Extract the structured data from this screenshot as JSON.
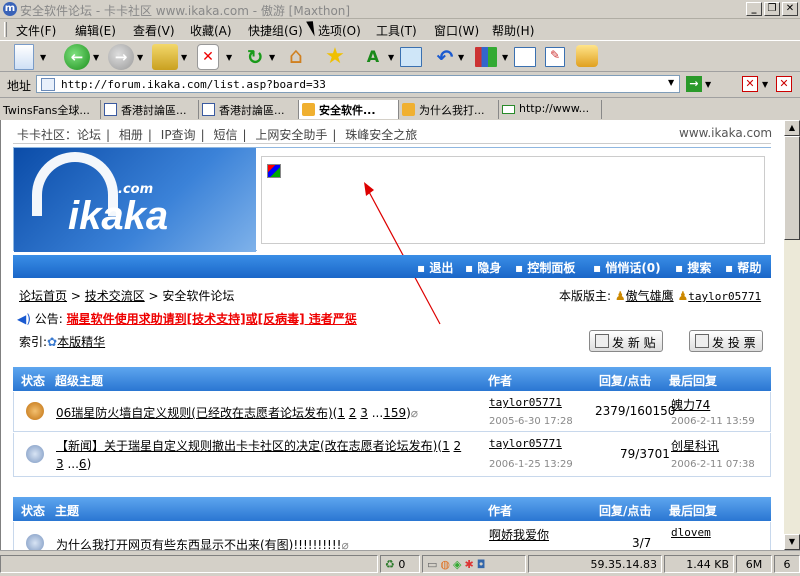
{
  "window": {
    "title": "安全软件论坛 - 卡卡社区 www.ikaka.com - 傲游 [Maxthon]"
  },
  "menu": [
    "文件(F)",
    "编辑(E)",
    "查看(V)",
    "收藏(A)",
    "快捷组(G)",
    "选项(O)",
    "工具(T)",
    "窗口(W)",
    "帮助(H)"
  ],
  "address": {
    "label": "地址",
    "url": "http://forum.ikaka.com/list.asp?board=33"
  },
  "tabs": [
    {
      "label": "TwinsFans全球..."
    },
    {
      "label": "香港討論區..."
    },
    {
      "label": "香港討論區..."
    },
    {
      "label": "安全软件..."
    },
    {
      "label": "为什么我打..."
    },
    {
      "label": "http://www..."
    }
  ],
  "page": {
    "toplinks": [
      "卡卡社区：论坛",
      "相册",
      "IP查询",
      "短信",
      "上网安全助手",
      "珠峰安全之旅"
    ],
    "site_url": "www.ikaka.com",
    "logo_text": "ikaka",
    "logo_com": ".com",
    "nav": [
      "退出",
      "隐身",
      "控制面板",
      "悄悄话(0)",
      "搜索",
      "帮助"
    ],
    "breadcrumb": {
      "home": "论坛首页",
      "section": "技术交流区",
      "current": "安全软件论坛"
    },
    "moderators": {
      "label": "本版版主:",
      "users": [
        "傲气雄鹰",
        "taylor05771"
      ]
    },
    "announcement": {
      "label": "公告:",
      "text": "瑞星软件使用求助请到[技术支持]或[反病毒] 违者严惩"
    },
    "index": {
      "label": "索引:",
      "link": "本版精华"
    },
    "buttons": {
      "new_post": "发 新 贴",
      "new_poll": "发 投 票"
    },
    "pinned_header": {
      "status": "状态",
      "topic": "超级主题",
      "author": "作者",
      "replies": "回复/点击",
      "last": "最后回复"
    },
    "pinned": [
      {
        "title": "06瑞星防火墙自定义规则(已经改在志愿者论坛发布)",
        "pages": [
          "1",
          "2",
          "3",
          "...",
          "159"
        ],
        "author": "taylor05771",
        "date": "2005-6-30 17:28",
        "stats": "2379/160150",
        "last_user": "魄力74",
        "last_date": "2006-2-11 13:59"
      },
      {
        "title": "【新闻】关于瑞星自定义规则撤出卡卡社区的决定(改在志愿者论坛发布)",
        "pages_open": "(",
        "pages": [
          "1",
          "2",
          "3",
          "...",
          "6"
        ],
        "author": "taylor05771",
        "date": "2006-1-25 13:29",
        "stats": "79/3701",
        "last_user": "创星科讯",
        "last_date": "2006-2-11 07:38"
      }
    ],
    "normal_header": {
      "status": "状态",
      "topic": "主题",
      "author": "作者",
      "replies": "回复/点击",
      "last": "最后回复"
    },
    "normal": [
      {
        "title": "为什么我打开网页有些东西显示不出来(有图)!!!!!!!!!!",
        "author": "啊娇我爱你",
        "stats": "3/7",
        "last_user": "dlovem"
      }
    ]
  },
  "status": {
    "count": "0",
    "ip": "59.35.14.83",
    "speed": "1.44 KB",
    "mem": "6M",
    "num": "6"
  }
}
